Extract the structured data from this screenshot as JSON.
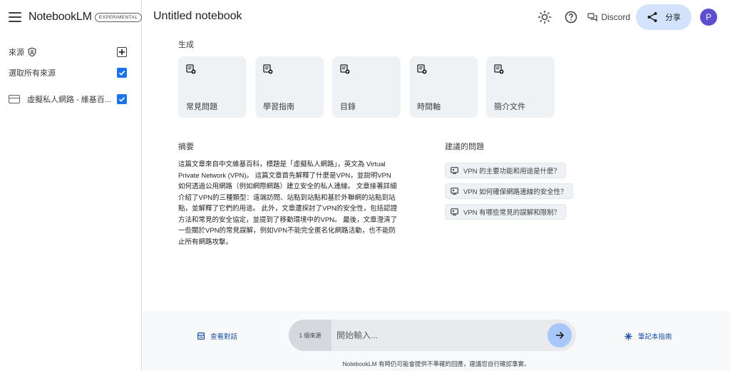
{
  "app": {
    "name": "NotebookLM",
    "badge": "EXPERIMENTAL"
  },
  "sidebar": {
    "sources_label": "來源",
    "select_all_label": "選取所有來源",
    "sources": [
      {
        "title": "虛擬私人網路 - 維基百..."
      }
    ]
  },
  "header": {
    "notebook_title": "Untitled notebook",
    "discord_label": "Discord",
    "share_label": "分享",
    "avatar_initial": "P"
  },
  "generate": {
    "title": "生成",
    "cards": [
      {
        "label": "常見問題"
      },
      {
        "label": "學習指南"
      },
      {
        "label": "目錄"
      },
      {
        "label": "時間軸"
      },
      {
        "label": "簡介文件"
      }
    ]
  },
  "summary": {
    "title": "摘要",
    "lines": [
      "這篇文章來自中文維基百科，標題是「虛擬私人網路」，英文為 Virtual",
      "Private Network (VPN)。 這篇文章首先解釋了什麼是VPN，並說明VPN",
      "如何透過公用網路（例如網際網路）建立安全的私人連線。 文章接著詳細",
      "介紹了VPN的三種類型：遠端訪問、站點到站點和基於外聯網的站點到站",
      "點，並解釋了它們的用途。 此外，文章還探討了VPN的安全性，包括認證",
      "方法和常見的安全協定，並提到了移動環境中的VPN。 最後，文章澄清了",
      "一些關於VPN的常見誤解，例如VPN不能完全匿名化網路活動，也不能防",
      "止所有網路攻擊。"
    ]
  },
  "suggested": {
    "title": "建議的問題",
    "questions": [
      "VPN 的主要功能和用途是什麼？",
      "VPN 如何確保網路連線的安全性？",
      "VPN 有哪些常見的誤解和限制？"
    ]
  },
  "bottom": {
    "view_chat": "查看對話",
    "source_count": "1 個來源",
    "input_placeholder": "開始輸入...",
    "notebook_guide": "筆記本指南",
    "disclaimer": "NotebookLM 有時仍可能會提供不準確的回應，建議您自行確認事實。"
  },
  "colors": {
    "accent": "#1a73e8",
    "share_bg": "#d3e3fd",
    "send_bg": "#a8c7fa",
    "avatar_bg": "#5e4dcd",
    "card_bg": "#eff2f5"
  },
  "icons": [
    "menu-icon",
    "shield-icon",
    "add-source-icon",
    "checkbox-icon",
    "document-icon",
    "brightness-icon",
    "help-icon",
    "discord-icon",
    "share-icon",
    "note-add-icon",
    "chat-history-icon",
    "send-arrow-icon",
    "sparkle-icon"
  ]
}
